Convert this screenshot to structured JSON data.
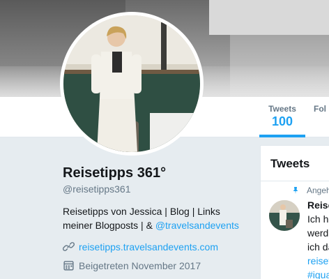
{
  "nav": {
    "tweets_label": "Tweets",
    "tweets_count": "100",
    "following_label_partial": "Fol"
  },
  "profile": {
    "name": "Reisetipps 361°",
    "handle": "@reisetipps361",
    "bio_text": "Reisetipps von Jessica | Blog | Links meiner Blogposts | & ",
    "bio_mention": "@travelsandevents",
    "url": "reisetipps.travelsandevents.com",
    "joined": "Beigetreten November 2017",
    "url_icon": "link-icon",
    "joined_icon": "calendar-icon"
  },
  "timeline": {
    "title": "Tweets",
    "pinned_label_partial": "Angeh",
    "tweet": {
      "author_partial": "Reise",
      "line1_partial": "Ich ha",
      "line2_partial": "werd",
      "line3_partial": "ich da",
      "link_partial": "reiset",
      "hashtag_partial": "#igua"
    }
  },
  "colors": {
    "accent": "#1da1f2",
    "text": "#14171a",
    "secondary_text": "#657786",
    "background": "#e6ecf0"
  }
}
